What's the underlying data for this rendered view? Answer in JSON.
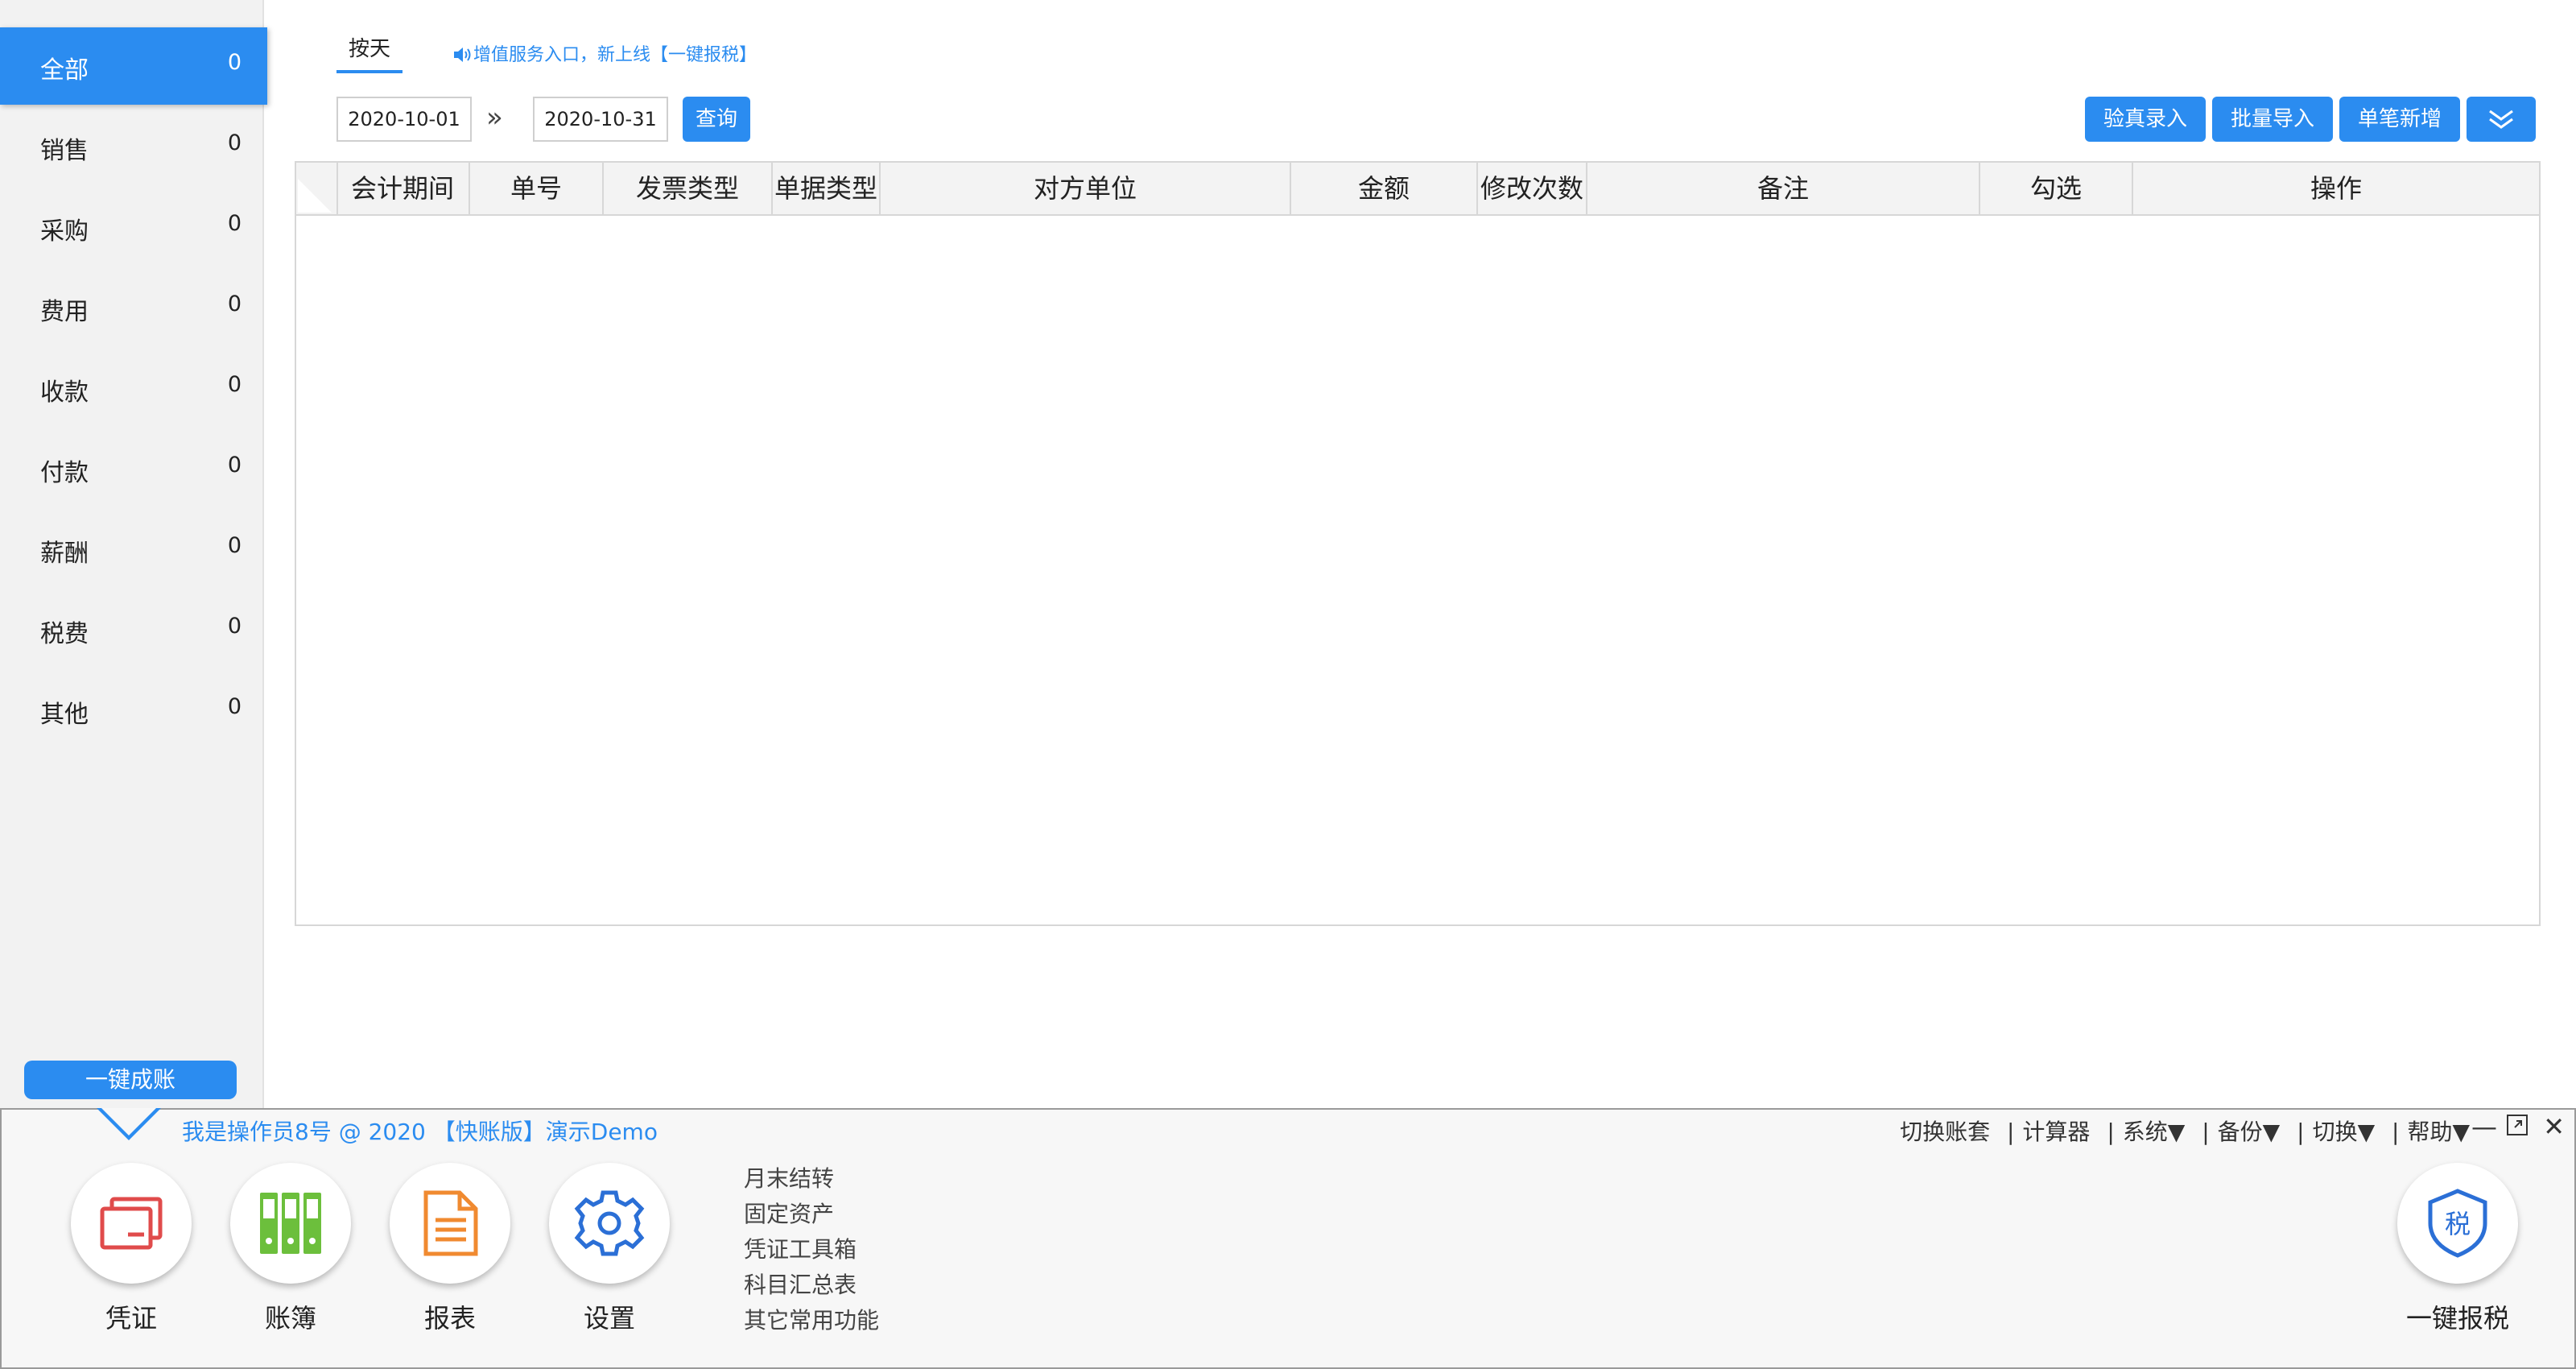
{
  "sidebar": {
    "items": [
      {
        "label": "全部",
        "count": "0"
      },
      {
        "label": "销售",
        "count": "0"
      },
      {
        "label": "采购",
        "count": "0"
      },
      {
        "label": "费用",
        "count": "0"
      },
      {
        "label": "收款",
        "count": "0"
      },
      {
        "label": "付款",
        "count": "0"
      },
      {
        "label": "薪酬",
        "count": "0"
      },
      {
        "label": "税费",
        "count": "0"
      },
      {
        "label": "其他",
        "count": "0"
      }
    ],
    "bottom_button": "一键成账"
  },
  "header": {
    "tab_label": "按天",
    "notice": "增值服务入口，新上线【一键报税】",
    "date_from": "2020-10-01",
    "date_to": "2020-10-31",
    "date_separator": "»",
    "query_button": "查询",
    "actions": [
      "验真录入",
      "批量导入",
      "单笔新增"
    ],
    "more_icon": "double-chevron-down-icon",
    "accent_color": "#2b8cf0"
  },
  "table": {
    "columns": [
      "会计期间",
      "单号",
      "发票类型",
      "单据类型",
      "对方单位",
      "金额",
      "修改次数",
      "备注",
      "勾选",
      "操作"
    ],
    "rows": []
  },
  "panel": {
    "user_info": "我是操作员8号 @ 2020 【快账版】演示Demo",
    "top_links": [
      "切换账套",
      "计算器",
      "系统▼",
      "备份▼",
      "切换▼",
      "帮助▼"
    ],
    "big_buttons": [
      {
        "label": "凭证",
        "icon": "voucher-icon",
        "color": "#e04b4b"
      },
      {
        "label": "账簿",
        "icon": "ledger-icon",
        "color": "#6cbf3c"
      },
      {
        "label": "报表",
        "icon": "report-icon",
        "color": "#f08a30"
      },
      {
        "label": "设置",
        "icon": "settings-gear-icon",
        "color": "#2b6fd6"
      }
    ],
    "quick_links": [
      "月末结转",
      "固定资产",
      "凭证工具箱",
      "科目汇总表",
      "其它常用功能"
    ],
    "tax_button": {
      "label": "一键报税",
      "icon": "tax-shield-icon",
      "glyph": "税"
    }
  }
}
